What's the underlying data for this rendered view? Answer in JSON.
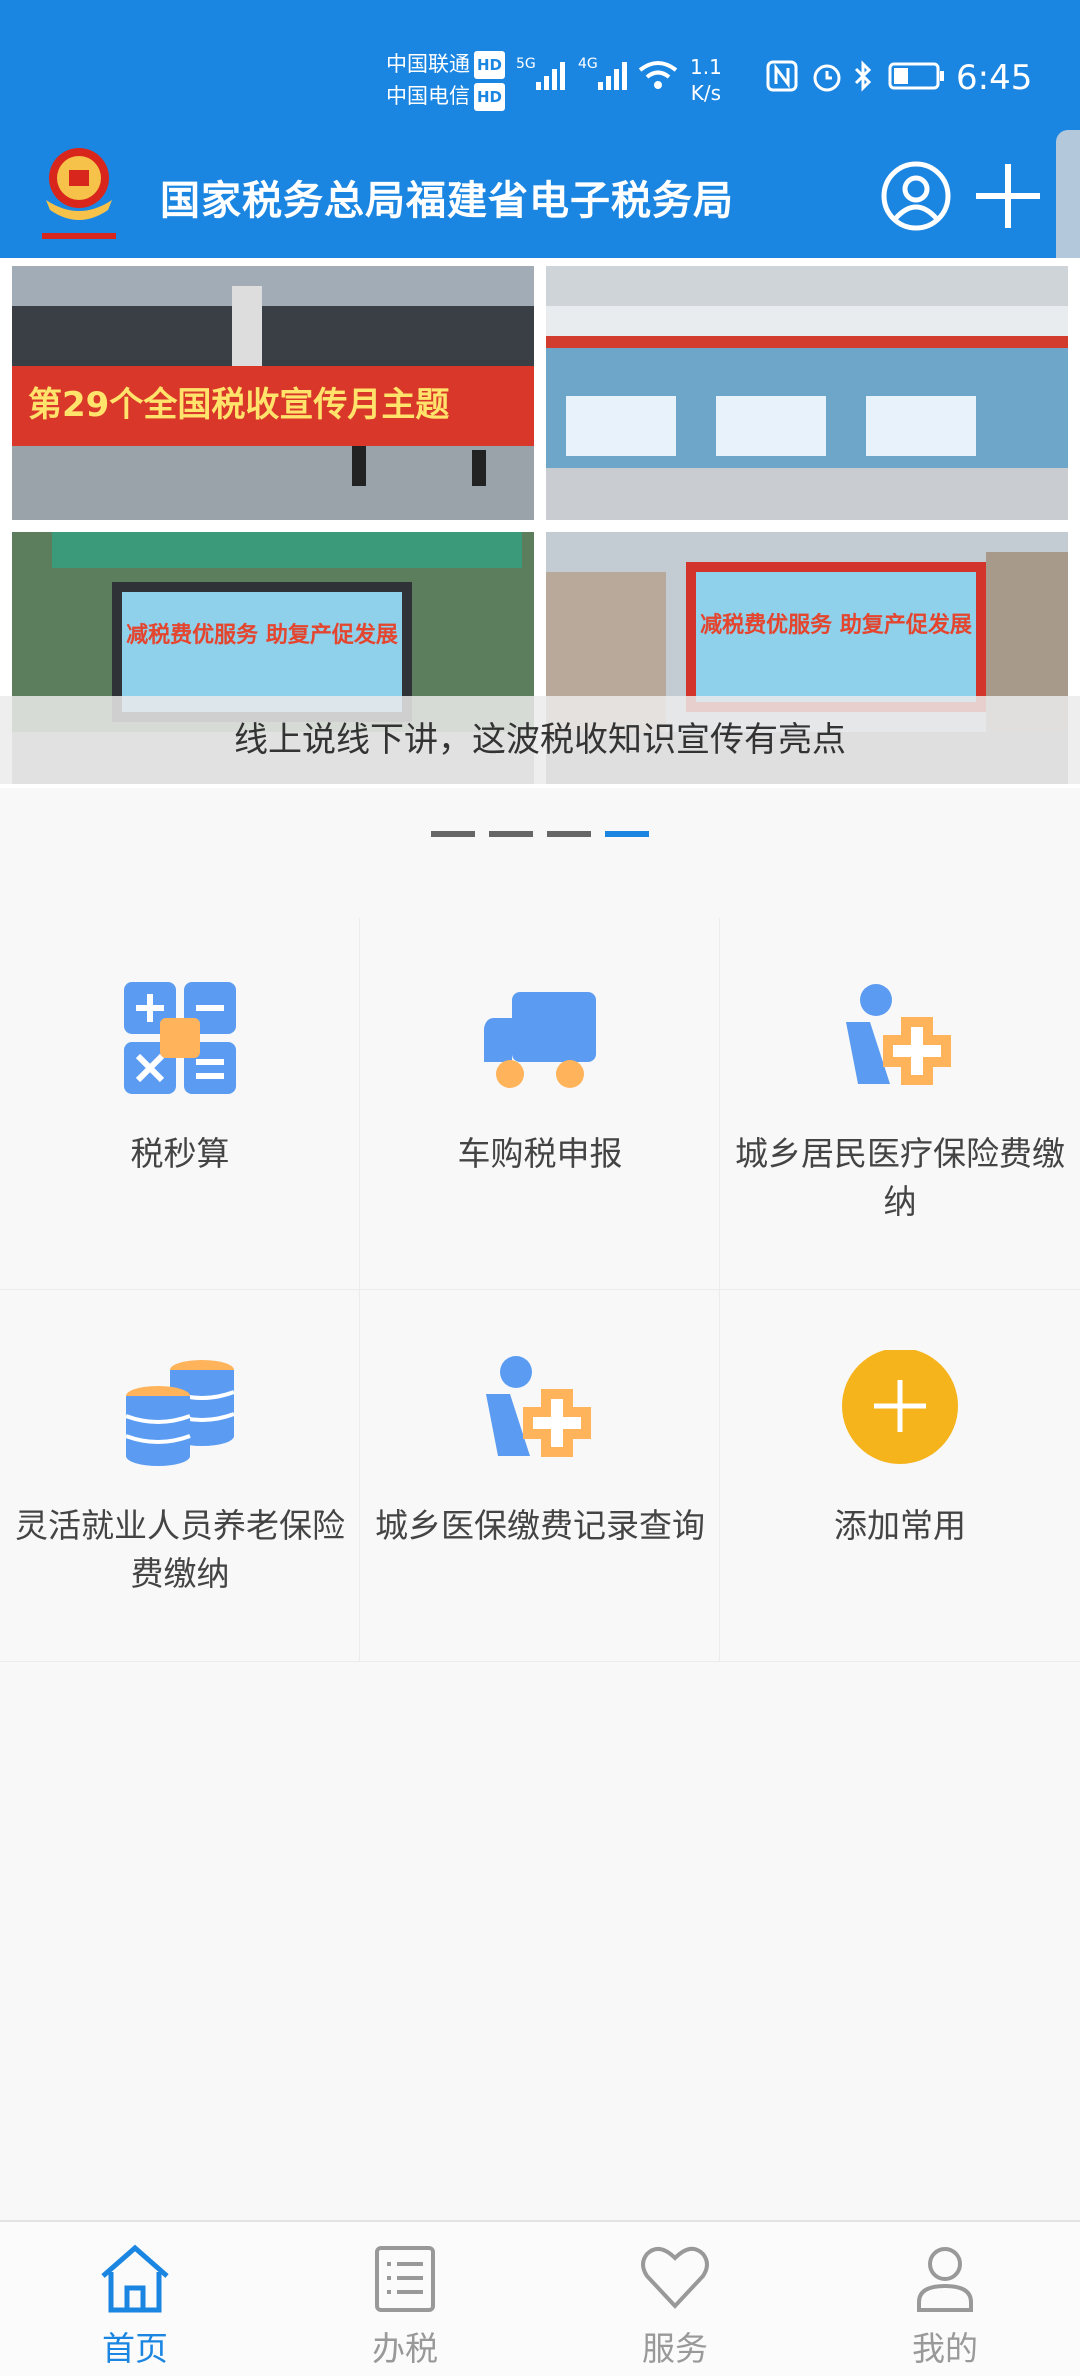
{
  "status_bar": {
    "carrier1": "中国联通",
    "carrier2": "中国电信",
    "hd_badge": "HD",
    "net1": "5G",
    "net2": "4G",
    "speed_value": "1.1",
    "speed_unit": "K/s",
    "time": "6:45"
  },
  "header": {
    "title": "国家税务总局福建省电子税务局"
  },
  "banner": {
    "caption": "线上说线下讲，这波税收知识宣传有亮点",
    "photo1_text": "第29个全国税收宣传月主题",
    "photo3_text": "减税费优服务 助复产促发展",
    "photo4_text": "减税费优服务 助复产促发展",
    "page_count": 4,
    "active_page": 4
  },
  "quick_actions": [
    {
      "label": "税秒算",
      "icon": "tax-calculator-icon"
    },
    {
      "label": "车购税申报",
      "icon": "truck-icon"
    },
    {
      "label": "城乡居民医疗保险费缴纳",
      "icon": "medical-insurance-icon"
    },
    {
      "label": "灵活就业人员养老保险费缴纳",
      "icon": "coins-stack-icon"
    },
    {
      "label": "城乡医保缴费记录查询",
      "icon": "medical-insurance-icon"
    },
    {
      "label": "添加常用",
      "icon": "plus-circle-icon"
    }
  ],
  "tabs": [
    {
      "label": "首页",
      "icon": "home-icon"
    },
    {
      "label": "办税",
      "icon": "list-icon"
    },
    {
      "label": "服务",
      "icon": "heart-icon"
    },
    {
      "label": "我的",
      "icon": "person-icon"
    }
  ],
  "colors": {
    "brand_blue": "#1b86e2",
    "icon_blue": "#5b9cf2",
    "icon_orange": "#ffb35a",
    "add_yellow": "#f5b31c"
  }
}
